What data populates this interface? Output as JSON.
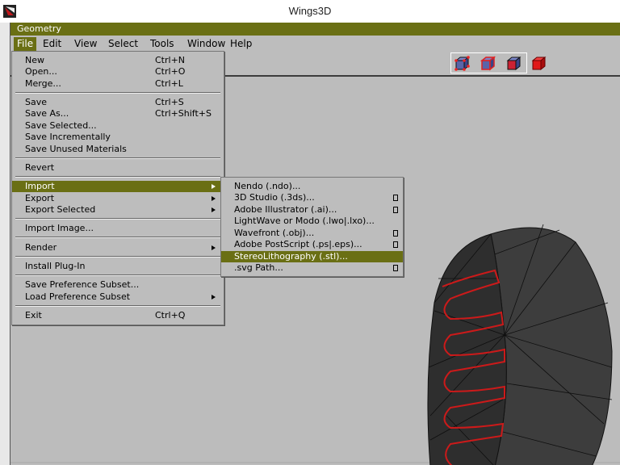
{
  "window": {
    "title": "Wings3D",
    "icon": "wings3d-app-icon"
  },
  "geometry_bar": {
    "title": "Geometry"
  },
  "menubar": {
    "items": [
      {
        "label": "File",
        "active": true
      },
      {
        "label": "Edit"
      },
      {
        "label": "View"
      },
      {
        "label": "Select"
      },
      {
        "label": "Tools"
      },
      {
        "label": "Window"
      },
      {
        "label": "Help"
      }
    ]
  },
  "toolbar": {
    "modes": [
      {
        "name": "vertex-mode",
        "icon": "vertex-cube-icon"
      },
      {
        "name": "edge-mode",
        "icon": "edge-cube-icon"
      },
      {
        "name": "face-mode",
        "icon": "face-cube-icon"
      },
      {
        "name": "body-mode",
        "icon": "body-cube-icon",
        "active": true
      }
    ]
  },
  "file_menu": {
    "items": [
      {
        "label": "New",
        "shortcut": "Ctrl+N"
      },
      {
        "label": "Open...",
        "shortcut": "Ctrl+O"
      },
      {
        "label": "Merge...",
        "shortcut": "Ctrl+L"
      },
      {
        "label": "Save",
        "shortcut": "Ctrl+S"
      },
      {
        "label": "Save As...",
        "shortcut": "Ctrl+Shift+S"
      },
      {
        "label": "Save Selected...",
        "shortcut": ""
      },
      {
        "label": "Save Incrementally",
        "shortcut": ""
      },
      {
        "label": "Save Unused Materials",
        "shortcut": ""
      },
      {
        "label": "Revert",
        "shortcut": ""
      },
      {
        "label": "Import",
        "shortcut": "",
        "submenu": true,
        "selected": true
      },
      {
        "label": "Export",
        "shortcut": "",
        "submenu": true
      },
      {
        "label": "Export Selected",
        "shortcut": "",
        "submenu": true
      },
      {
        "label": "Import Image...",
        "shortcut": ""
      },
      {
        "label": "Render",
        "shortcut": "",
        "submenu": true
      },
      {
        "label": "Install Plug-In",
        "shortcut": ""
      },
      {
        "label": "Save Preference Subset...",
        "shortcut": ""
      },
      {
        "label": "Load Preference Subset",
        "shortcut": "",
        "submenu": true
      },
      {
        "label": "Exit",
        "shortcut": "Ctrl+Q"
      }
    ]
  },
  "import_submenu": {
    "items": [
      {
        "label": "Nendo (.ndo)...",
        "options": false
      },
      {
        "label": "3D Studio (.3ds)...",
        "options": true
      },
      {
        "label": "Adobe Illustrator (.ai)...",
        "options": true
      },
      {
        "label": "LightWave or Modo (.lwo|.lxo)...",
        "options": false
      },
      {
        "label": "Wavefront (.obj)...",
        "options": true
      },
      {
        "label": "Adobe PostScript (.ps|.eps)...",
        "options": true
      },
      {
        "label": "StereoLithography (.stl)...",
        "options": false,
        "selected": true
      },
      {
        "label": ".svg Path...",
        "options": true
      }
    ]
  },
  "colors": {
    "accent": "#6a6f14",
    "menu_bg": "#bdbdbd",
    "viewport_bg": "#bcbcbc",
    "model_fill": "#3a3a3a",
    "selection_edge": "#cc1a1a"
  }
}
